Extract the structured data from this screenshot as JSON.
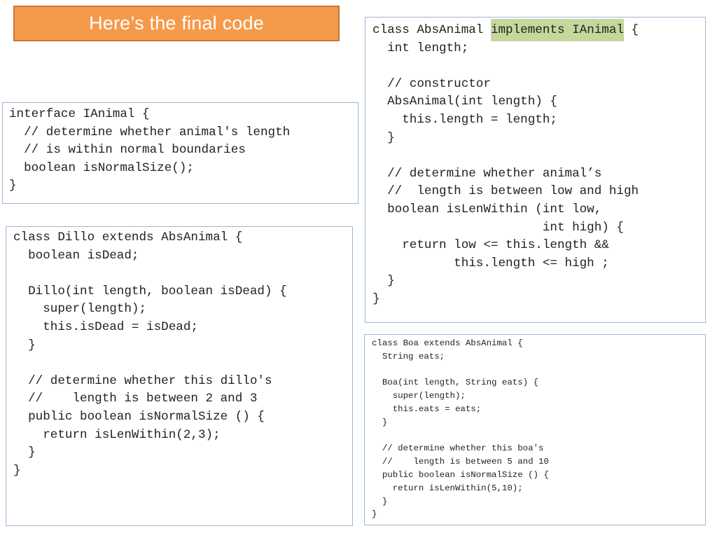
{
  "title": "Here’s the final code",
  "colors": {
    "title_fill": "#f59a4a",
    "title_border": "#c7763a",
    "title_text": "#ffffff",
    "box_border": "#9fb6d3",
    "highlight": "#c5d79a",
    "code_text": "#222222"
  },
  "interface_box": {
    "lines": [
      "interface IAnimal {",
      "  // determine whether animal's length",
      "  // is within normal boundaries",
      "  boolean isNormalSize();",
      "}"
    ]
  },
  "dillo_box": {
    "lines": [
      "class Dillo extends AbsAnimal {",
      "  boolean isDead;",
      "",
      "  Dillo(int length, boolean isDead) {",
      "    super(length);",
      "    this.isDead = isDead;",
      "  }",
      "",
      "  // determine whether this dillo's",
      "  //    length is between 2 and 3",
      "  public boolean isNormalSize () {",
      "    return isLenWithin(2,3);",
      "  }",
      "}"
    ]
  },
  "absanimal_box": {
    "first_line": {
      "before": "class AbsAnimal ",
      "highlighted": "implements IAnimal",
      "after": " {"
    },
    "lines": [
      "  int length;",
      "",
      "  // constructor",
      "  AbsAnimal(int length) {",
      "    this.length = length;",
      "  }",
      "",
      "  // determine whether animal’s",
      "  //  length is between low and high",
      "  boolean isLenWithin (int low,",
      "                       int high) {",
      "    return low <= this.length &&",
      "           this.length <= high ;",
      "  }",
      "}"
    ]
  },
  "boa_box": {
    "lines": [
      "class Boa extends AbsAnimal {",
      "  String eats;",
      "",
      "  Boa(int length, String eats) {",
      "    super(length);",
      "    this.eats = eats;",
      "  }",
      "",
      "  // determine whether this boa's",
      "  //    length is between 5 and 10",
      "  public boolean isNormalSize () {",
      "    return isLenWithin(5,10);",
      "  }",
      "}"
    ]
  }
}
